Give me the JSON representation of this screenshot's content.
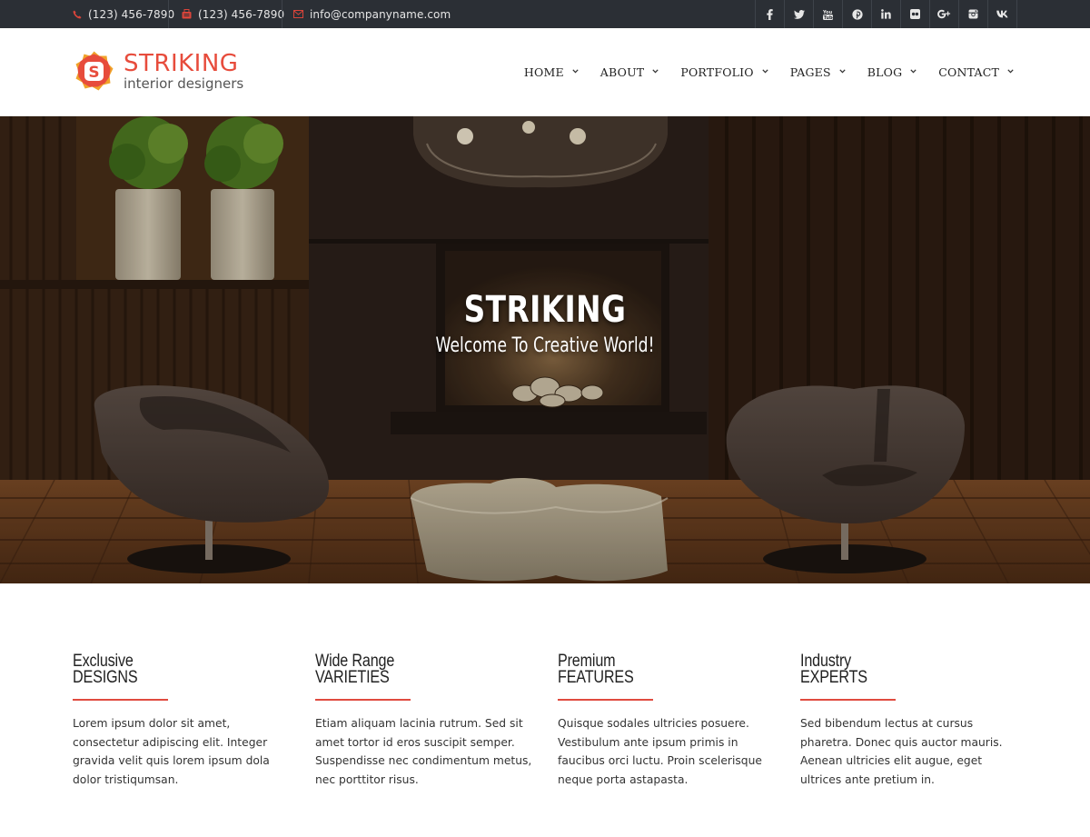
{
  "topbar": {
    "phone1": "(123) 456-7890",
    "phone2": "(123) 456-7890",
    "email": "info@companyname.com",
    "social": [
      {
        "icon": "facebook-icon",
        "glyph": "f"
      },
      {
        "icon": "twitter-icon",
        "glyph": "t"
      },
      {
        "icon": "youtube-icon",
        "glyph": "▶"
      },
      {
        "icon": "pinterest-icon",
        "glyph": "p"
      },
      {
        "icon": "linkedin-icon",
        "glyph": "in"
      },
      {
        "icon": "flickr-icon",
        "glyph": "••"
      },
      {
        "icon": "google-plus-icon",
        "glyph": "G+"
      },
      {
        "icon": "instagram-icon",
        "glyph": "◘"
      },
      {
        "icon": "vk-icon",
        "glyph": "vk"
      }
    ]
  },
  "logo": {
    "letter": "S",
    "name": "STRIKING",
    "tagline": "interior designers"
  },
  "nav": {
    "items": [
      {
        "label": "HOME"
      },
      {
        "label": "ABOUT"
      },
      {
        "label": "PORTFOLIO"
      },
      {
        "label": "PAGES"
      },
      {
        "label": "BLOG"
      },
      {
        "label": "CONTACT"
      }
    ]
  },
  "hero": {
    "title": "STRIKING",
    "subtitle": "Welcome To Creative World!"
  },
  "features": [
    {
      "line1": "Exclusive",
      "line2": "DESIGNS",
      "text": "Lorem ipsum dolor sit amet, consectetur adipiscing elit. Integer gravida velit quis lorem ipsum dola dolor tristiqumsan."
    },
    {
      "line1": "Wide Range",
      "line2": "VARIETIES",
      "text": "Etiam aliquam lacinia rutrum. Sed sit amet tortor id eros suscipit semper. Suspendisse nec condimentum metus, nec porttitor risus."
    },
    {
      "line1": "Premium",
      "line2": "FEATURES",
      "text": "Quisque sodales ultricies posuere. Vestibulum ante ipsum primis in faucibus orci luctu. Proin scelerisque neque porta astapasta."
    },
    {
      "line1": "Industry",
      "line2": "EXPERTS",
      "text": "Sed bibendum lectus at cursus pharetra. Donec quis auctor mauris. Aenean ultricies elit augue, eget ultrices ante pretium in."
    }
  ],
  "colors": {
    "accent": "#e74c3c",
    "topbar": "#2b2f35"
  }
}
